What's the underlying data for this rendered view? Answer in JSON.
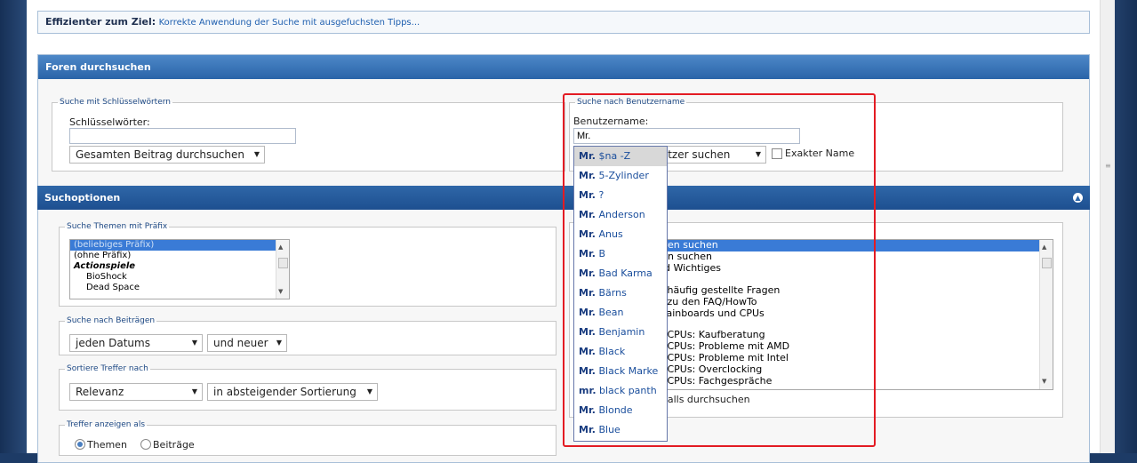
{
  "tipbar": {
    "bold": "Effizienter zum Ziel:",
    "link": "Korrekte Anwendung der Suche mit ausgefuchsten Tipps..."
  },
  "panel": {
    "title": "Foren durchsuchen"
  },
  "keywords": {
    "legend": "Suche mit Schlüsselwörtern",
    "label": "Schlüsselwörter:",
    "value": "",
    "scope_select": "Gesamten Beitrag durchsuchen"
  },
  "username": {
    "legend": "Suche nach Benutzername",
    "label": "Benutzername:",
    "value": "Mr.",
    "select_partial": "nutzer suchen",
    "exact_label": "Exakter Name"
  },
  "autocomplete": [
    {
      "bold": "Mr.",
      "rest": " $na -Z"
    },
    {
      "bold": "Mr.",
      "rest": " 5-Zylinder"
    },
    {
      "bold": "Mr.",
      "rest": " ?"
    },
    {
      "bold": "Mr.",
      "rest": " Anderson"
    },
    {
      "bold": "Mr.",
      "rest": " Anus"
    },
    {
      "bold": "Mr.",
      "rest": " B"
    },
    {
      "bold": "Mr.",
      "rest": " Bad Karma"
    },
    {
      "bold": "Mr.",
      "rest": " Bärns"
    },
    {
      "bold": "Mr.",
      "rest": " Bean"
    },
    {
      "bold": "Mr.",
      "rest": " Benjamin"
    },
    {
      "bold": "Mr.",
      "rest": " Black"
    },
    {
      "bold": "Mr.",
      "rest": " Black Marke"
    },
    {
      "bold": "mr.",
      "rest": " black panth"
    },
    {
      "bold": "Mr.",
      "rest": " Blonde"
    },
    {
      "bold": "Mr.",
      "rest": " Blue"
    }
  ],
  "options": {
    "title": "Suchoptionen"
  },
  "prefix": {
    "legend": "Suche Themen mit Präfix",
    "items": [
      "(beliebiges Präfix)",
      "(ohne Präfix)",
      "Actionspiele",
      "BioShock",
      "Dead Space"
    ]
  },
  "posts": {
    "legend": "Suche nach Beiträgen",
    "date_select": "jeden Datums",
    "dir_select": "und neuer"
  },
  "sort": {
    "legend": "Sortiere Treffer nach",
    "field_select": "Relevanz",
    "order_select": "in absteigender Sortierung"
  },
  "display": {
    "legend": "Treffer anzeigen als",
    "opt_threads": "Themen",
    "opt_posts": "Beiträge"
  },
  "forums": {
    "items": [
      "oren suchen",
      "ren suchen",
      "nd Wichtiges",
      "",
      "d häufig gestellte Fragen",
      "n zu den FAQ/HowTo",
      "Mainboards und CPUs",
      "",
      "d CPUs: Kaufberatung",
      "d CPUs: Probleme mit AMD",
      "d CPUs: Probleme mit Intel",
      "d CPUs: Overclocking",
      "d CPUs: Fachgespräche"
    ],
    "child_label": "nfalls durchsuchen"
  },
  "colors": {
    "highlight_border": "#e31b23",
    "header_blue": "#2a64a8"
  }
}
